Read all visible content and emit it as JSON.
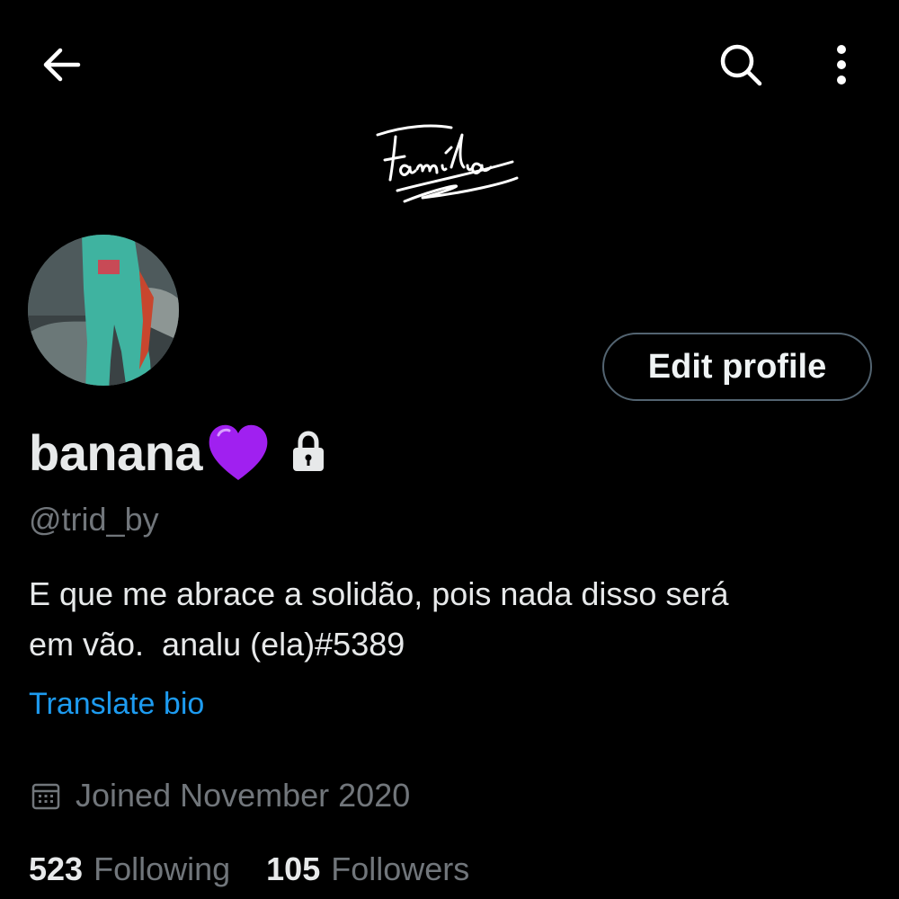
{
  "header": {
    "back_icon": "arrow-left-icon",
    "search_icon": "search-icon",
    "more_icon": "more-vertical-icon"
  },
  "banner": {
    "signature_text": "Família"
  },
  "profile": {
    "display_name": "banana",
    "name_emoji": "purple-heart",
    "protected_icon": "lock-icon",
    "handle": "@trid_by",
    "bio_line1": "E que me abrace a solidão, pois nada disso será",
    "bio_line2": "em vão.  analu (ela)#5389",
    "translate_label": "Translate bio",
    "joined_icon": "calendar-icon",
    "joined": "Joined November 2020"
  },
  "actions": {
    "edit_profile_label": "Edit profile"
  },
  "stats": {
    "following_count": "523",
    "following_label": "Following",
    "followers_count": "105",
    "followers_label": "Followers"
  },
  "colors": {
    "background": "#000000",
    "text_primary": "#e7e9ea",
    "text_secondary": "#71767b",
    "link": "#1d9bf0",
    "button_border": "#536471",
    "heart": "#a020f0"
  }
}
